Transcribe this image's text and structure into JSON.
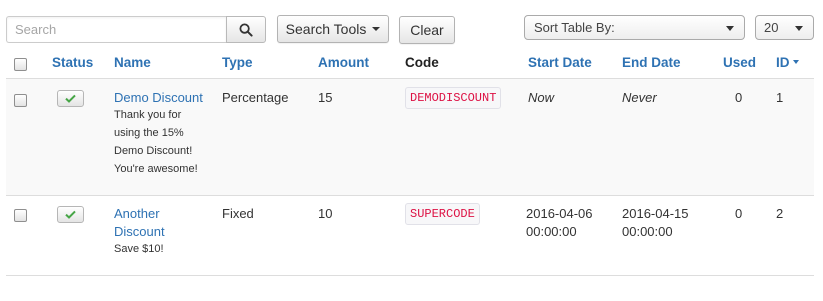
{
  "toolbar": {
    "search_placeholder": "Search",
    "search_tools_label": "Search Tools",
    "clear_label": "Clear",
    "sort_select_value": "Sort Table By:",
    "limit_select_value": "20"
  },
  "table": {
    "columns": {
      "status": "Status",
      "name": "Name",
      "type": "Type",
      "amount": "Amount",
      "code": "Code",
      "start_date": "Start Date",
      "end_date": "End Date",
      "used": "Used",
      "id": "ID"
    },
    "rows": [
      {
        "name_line1": "Demo Discount",
        "name_line2": "",
        "desc_lines": [
          "Thank you for",
          "using the 15%",
          "Demo Discount!",
          "You're awesome!"
        ],
        "type": "Percentage",
        "amount": "15",
        "code": "DEMODISCOUNT",
        "start_date_line1": "Now",
        "start_date_line2": "",
        "end_date_line1": "Never",
        "end_date_line2": "",
        "used": "0",
        "id": "1",
        "published": true
      },
      {
        "name_line1": "Another",
        "name_line2": "Discount",
        "desc_lines": [
          "Save $10!"
        ],
        "type": "Fixed",
        "amount": "10",
        "code": "SUPERCODE",
        "start_date_line1": "2016-04-06",
        "start_date_line2": "00:00:00",
        "end_date_line1": "2016-04-15",
        "end_date_line2": "00:00:00",
        "used": "0",
        "id": "2",
        "published": true
      }
    ]
  },
  "colors": {
    "link": "#2e72b3",
    "code_text": "#dd1144",
    "status_check": "#46a546"
  },
  "icons": {
    "search_button": "search-icon",
    "status": "check-icon",
    "sort_direction": "caret-down-icon"
  }
}
